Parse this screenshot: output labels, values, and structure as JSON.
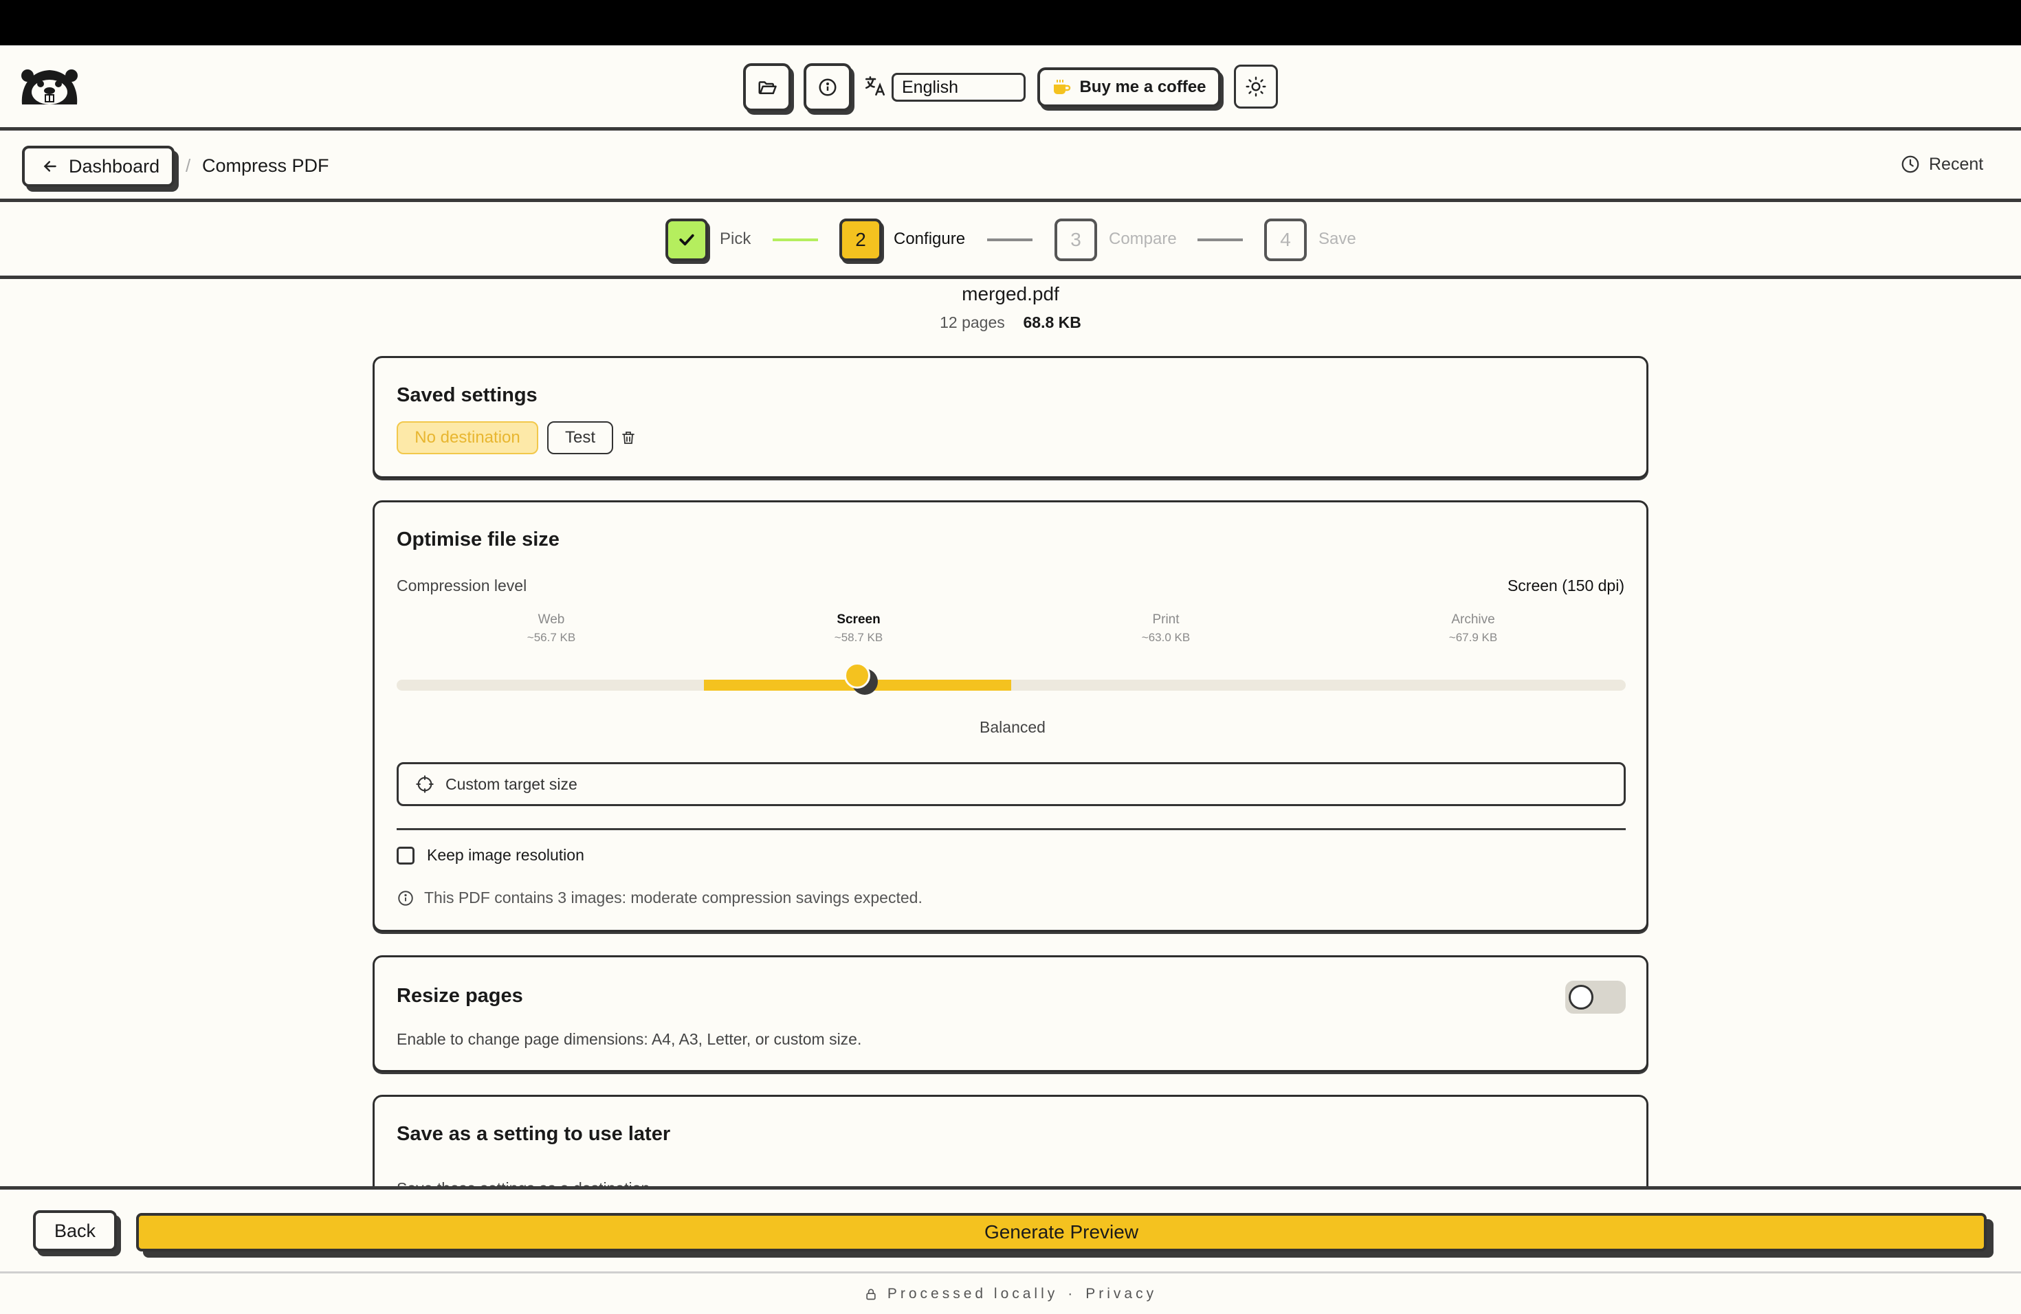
{
  "header": {
    "language": "English",
    "coffee_label": "Buy me a coffee",
    "icons": [
      "beaver-logo-icon",
      "folder-icon",
      "info-icon",
      "translate-icon",
      "coffee-icon",
      "sun-icon"
    ]
  },
  "breadcrumb": {
    "back_label": "Dashboard",
    "separator": "/",
    "current": "Compress PDF",
    "recent_label": "Recent"
  },
  "stepper": {
    "steps": [
      {
        "number": "",
        "label": "Pick",
        "state": "done"
      },
      {
        "number": "2",
        "label": "Configure",
        "state": "active"
      },
      {
        "number": "3",
        "label": "Compare",
        "state": "pending"
      },
      {
        "number": "4",
        "label": "Save",
        "state": "pending"
      }
    ]
  },
  "file": {
    "name": "merged.pdf",
    "pages": "12 pages",
    "size": "68.8 KB"
  },
  "saved_settings": {
    "title": "Saved settings",
    "chips": [
      "No destination",
      "Test"
    ]
  },
  "optimise": {
    "title": "Optimise file size",
    "compression_label": "Compression level",
    "compression_value": "Screen (150 dpi)",
    "levels": [
      {
        "name": "Web",
        "size": "~56.7 KB"
      },
      {
        "name": "Screen",
        "size": "~58.7 KB"
      },
      {
        "name": "Print",
        "size": "~63.0 KB"
      },
      {
        "name": "Archive",
        "size": "~67.9 KB"
      }
    ],
    "selected_level_index": 1,
    "slider_descriptor": "Balanced",
    "custom_target_label": "Custom target size",
    "keep_resolution_label": "Keep image resolution",
    "keep_resolution_checked": false,
    "info_text": "This PDF contains 3 images: moderate compression savings expected."
  },
  "resize": {
    "title": "Resize pages",
    "description": "Enable to change page dimensions: A4, A3, Letter, or custom size.",
    "enabled": false
  },
  "save_setting": {
    "title": "Save as a setting to use later",
    "description": "Save these settings as a destination"
  },
  "bottom": {
    "back_label": "Back",
    "generate_label": "Generate Preview"
  },
  "footer": {
    "processed": "Processed locally",
    "dot": "·",
    "privacy": "Privacy"
  },
  "colors": {
    "accent": "#f4c21f",
    "done_green": "#b5ee5e",
    "track": "#ede9de"
  }
}
